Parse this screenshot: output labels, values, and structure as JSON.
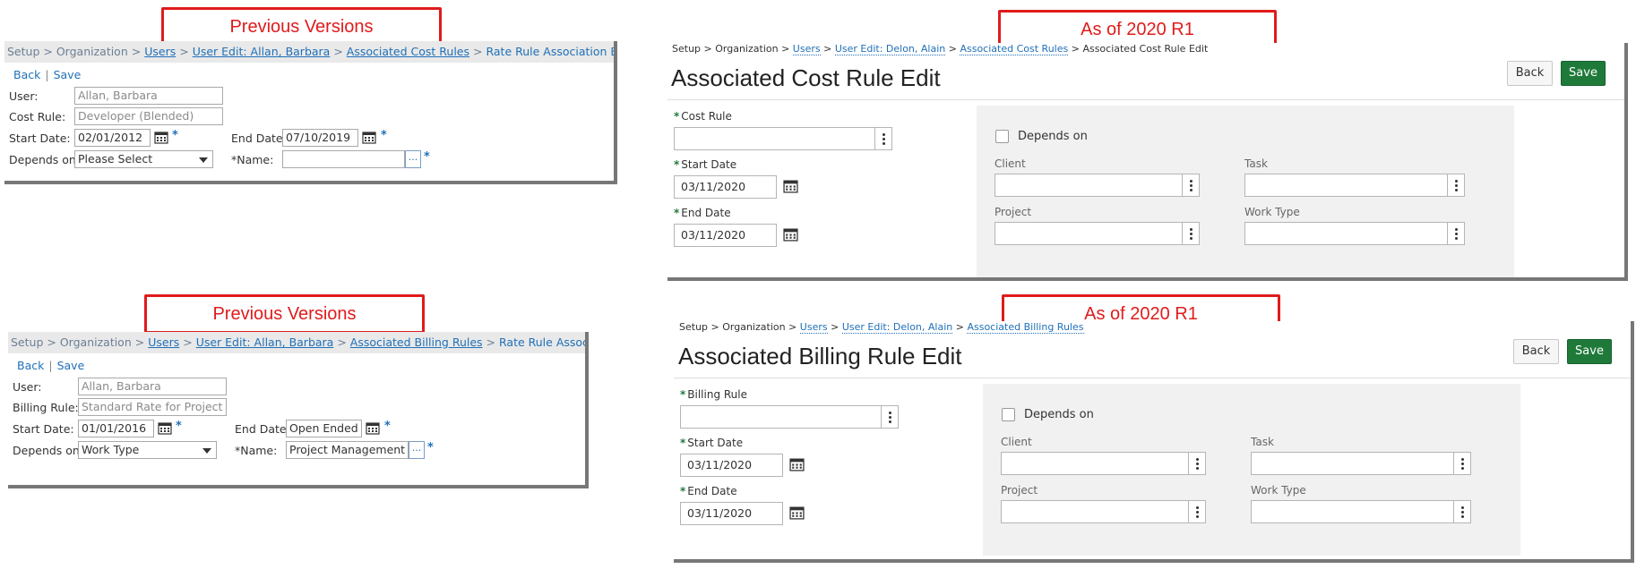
{
  "callouts": {
    "previous": "Previous Versions",
    "new": "As of 2020 R1"
  },
  "old_cost": {
    "breadcrumb": {
      "setup": "Setup",
      "sep": ">",
      "organization": "Organization",
      "users": "Users",
      "user_edit": "User Edit: Allan, Barbara",
      "assoc": "Associated Cost Rules",
      "current": "Rate Rule Association Edit"
    },
    "back": "Back",
    "link_sep": "|",
    "save": "Save",
    "user_label": "User:",
    "user_value": "Allan, Barbara",
    "rule_label": "Cost Rule:",
    "rule_value": "Developer (Blended)",
    "start_label": "Start Date:",
    "start_value": "02/01/2012",
    "end_label": "End Date:",
    "end_value": "07/10/2019",
    "depends_label": "Depends on:",
    "depends_value": "Please Select",
    "name_label": "*Name:",
    "name_value": "",
    "dots": "...",
    "star": "*"
  },
  "old_billing": {
    "breadcrumb": {
      "setup": "Setup",
      "sep": ">",
      "organization": "Organization",
      "users": "Users",
      "user_edit": "User Edit: Allan, Barbara",
      "assoc": "Associated Billing Rules",
      "current": "Rate Rule Association Edit"
    },
    "back": "Back",
    "link_sep": "|",
    "save": "Save",
    "user_label": "User:",
    "user_value": "Allan, Barbara",
    "rule_label": "Billing Rule:",
    "rule_value": "Standard Rate for Project Mar",
    "start_label": "Start Date:",
    "start_value": "01/01/2016",
    "end_label": "End Date:",
    "end_value": "Open Ended",
    "depends_label": "Depends on:",
    "depends_value": "Work Type",
    "name_label": "*Name:",
    "name_value": "Project Management",
    "dots": "...",
    "star": "*"
  },
  "new_cost": {
    "breadcrumb": {
      "setup": "Setup",
      "sep": ">",
      "organization": "Organization",
      "users": "Users",
      "user_edit": "User Edit: Delon, Alain",
      "assoc": "Associated Cost Rules",
      "current": "Associated Cost Rule Edit"
    },
    "title": "Associated Cost Rule Edit",
    "back": "Back",
    "save": "Save",
    "req": "*",
    "rule_label": "Cost Rule",
    "start_label": "Start Date",
    "start_value": "03/11/2020",
    "end_label": "End Date",
    "end_value": "03/11/2020",
    "depends_label": "Depends on",
    "client_label": "Client",
    "task_label": "Task",
    "project_label": "Project",
    "worktype_label": "Work Type"
  },
  "new_billing": {
    "breadcrumb": {
      "setup": "Setup",
      "sep": ">",
      "organization": "Organization",
      "users": "Users",
      "user_edit": "User Edit: Delon, Alain",
      "assoc": "Associated Billing Rules"
    },
    "title": "Associated Billing Rule Edit",
    "back": "Back",
    "save": "Save",
    "req": "*",
    "rule_label": "Billing Rule",
    "start_label": "Start Date",
    "start_value": "03/11/2020",
    "end_label": "End Date",
    "end_value": "03/11/2020",
    "depends_label": "Depends on",
    "client_label": "Client",
    "task_label": "Task",
    "project_label": "Project",
    "worktype_label": "Work Type"
  },
  "colors": {
    "callout": "#e01b1b",
    "link": "#1f70b8",
    "save_green": "#1f7a3a"
  }
}
